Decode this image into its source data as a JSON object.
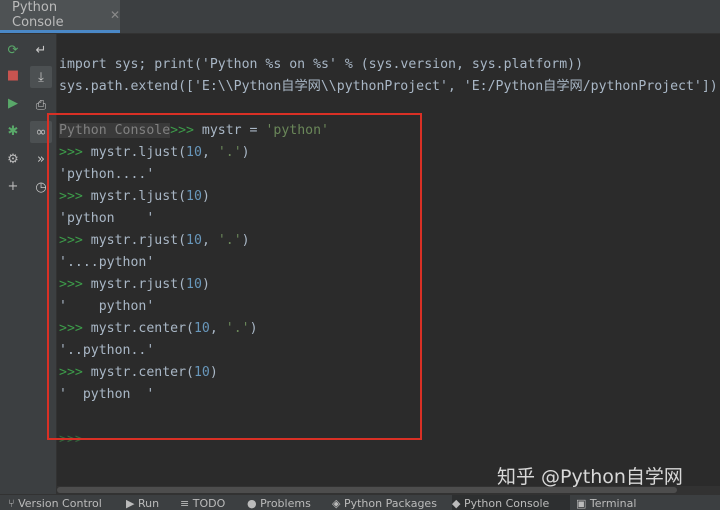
{
  "tab": {
    "title": "Python Console",
    "close": "✕"
  },
  "toolbar_left": [
    {
      "name": "rerun-icon",
      "glyph": "⟳",
      "color": "#59a869"
    },
    {
      "name": "stop-icon",
      "glyph": "■",
      "color": "#c75450"
    },
    {
      "name": "run-icon",
      "glyph": "▶",
      "color": "#59a869"
    },
    {
      "name": "debug-icon",
      "glyph": "✱",
      "color": "#59a869"
    },
    {
      "name": "settings-icon",
      "glyph": "⚙",
      "color": "#bbbbbb"
    },
    {
      "name": "add-icon",
      "glyph": "+",
      "color": "#bbbbbb"
    }
  ],
  "toolbar_right": [
    {
      "name": "soft-wrap-icon",
      "glyph": "↵"
    },
    {
      "name": "scroll-to-end-icon",
      "glyph": "⤓"
    },
    {
      "name": "print-icon",
      "glyph": "⎙"
    },
    {
      "name": "show-variables-icon",
      "glyph": "∞"
    },
    {
      "name": "history-next-icon",
      "glyph": "»"
    },
    {
      "name": "history-icon",
      "glyph": "◷"
    }
  ],
  "console": {
    "init1": "import sys; print('Python %s on %s' % (sys.version, sys.platform))",
    "init2": "sys.path.extend(['E:\\\\Python自学网\\\\pythonProject', 'E:/Python自学网/pythonProject'])",
    "label": "Python Console",
    "prompt": ">>>",
    "cmd0_pre": " mystr = ",
    "cmd0_str": "'python'",
    "cmd1_pre": " mystr.ljust(",
    "cmd1_num": "10",
    "cmd1_sep": ", ",
    "cmd1_str": "'.'",
    "cmd1_end": ")",
    "out1": "'python....'",
    "cmd2_pre": " mystr.ljust(",
    "cmd2_num": "10",
    "cmd2_end": ")",
    "out2": "'python    '",
    "cmd3_pre": " mystr.rjust(",
    "cmd3_num": "10",
    "cmd3_sep": ", ",
    "cmd3_str": "'.'",
    "cmd3_end": ")",
    "out3": "'....python'",
    "cmd4_pre": " mystr.rjust(",
    "cmd4_num": "10",
    "cmd4_end": ")",
    "out4": "'    python'",
    "cmd5_pre": " mystr.center(",
    "cmd5_num": "10",
    "cmd5_sep": ", ",
    "cmd5_str": "'.'",
    "cmd5_end": ")",
    "out5": "'..python..'",
    "cmd6_pre": " mystr.center(",
    "cmd6_num": "10",
    "cmd6_end": ")",
    "out6": "'  python  '",
    "final_prompt": ">>>"
  },
  "statusbar": [
    {
      "name": "status-version-control",
      "label": "Version Control"
    },
    {
      "name": "status-run",
      "label": "Run"
    },
    {
      "name": "status-todo",
      "label": "TODO"
    },
    {
      "name": "status-problems",
      "label": "Problems"
    },
    {
      "name": "status-python-packages",
      "label": "Python Packages"
    },
    {
      "name": "status-python-console",
      "label": "Python Console"
    },
    {
      "name": "status-terminal",
      "label": "Terminal"
    }
  ],
  "watermark": "知乎 @Python自学网"
}
